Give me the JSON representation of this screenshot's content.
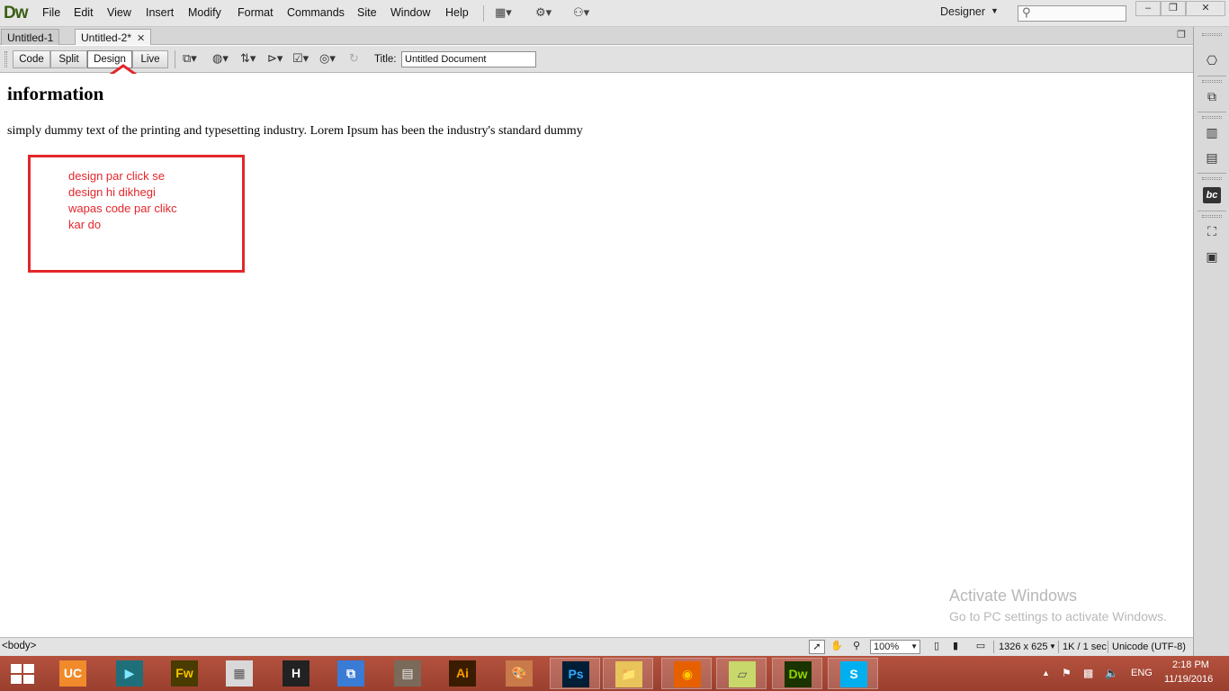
{
  "app": {
    "logo": "Dw",
    "menu": [
      "File",
      "Edit",
      "View",
      "Insert",
      "Modify",
      "Format",
      "Commands",
      "Site",
      "Window",
      "Help"
    ],
    "workspace": "Designer",
    "search_placeholder": "",
    "window_controls": [
      "–",
      "❐",
      "✕"
    ]
  },
  "tabs": [
    {
      "label": "Untitled-1",
      "active": false
    },
    {
      "label": "Untitled-2*",
      "active": true
    }
  ],
  "doc_toolbar": {
    "view_buttons": [
      "Code",
      "Split",
      "Design",
      "Live"
    ],
    "selected_view": "Design",
    "title_label": "Title:",
    "title_value": "Untitled Document"
  },
  "document": {
    "heading": "information",
    "paragraph": "simply dummy text of the printing and typesetting industry. Lorem Ipsum has been the industry's standard dummy"
  },
  "annotation": {
    "color": "#e3262b",
    "lines": [
      "design par click se",
      "design hi dikhegi",
      "wapas code par clikc",
      "kar do"
    ]
  },
  "watermark": {
    "title": "Activate Windows",
    "subtitle": "Go to PC settings to activate Windows."
  },
  "status_bar": {
    "tag_selector": "<body>",
    "zoom": "100%",
    "window_size": "1326 x 625",
    "download": "1K / 1 sec",
    "encoding": "Unicode (UTF-8)"
  },
  "taskbar": {
    "apps": [
      {
        "name": "uc-browser",
        "glyph": "UC",
        "bg": "#f08a2b",
        "fg": "#fff"
      },
      {
        "name": "media-player",
        "glyph": "▶",
        "bg": "#1f6f7a",
        "fg": "#7fe6ff"
      },
      {
        "name": "fireworks",
        "glyph": "Fw",
        "bg": "#4a3b00",
        "fg": "#f5c400"
      },
      {
        "name": "calculator",
        "glyph": "▦",
        "bg": "#d8d8d8",
        "fg": "#555"
      },
      {
        "name": "hyper-terminal",
        "glyph": "H",
        "bg": "#222",
        "fg": "#fff"
      },
      {
        "name": "network-tool",
        "glyph": "⧉",
        "bg": "#3a7bd5",
        "fg": "#fff"
      },
      {
        "name": "photos-app",
        "glyph": "▤",
        "bg": "#7a6a5a",
        "fg": "#eee"
      },
      {
        "name": "illustrator",
        "glyph": "Ai",
        "bg": "#3a1d00",
        "fg": "#ff9a00"
      },
      {
        "name": "paint",
        "glyph": "🎨",
        "bg": "#c87a4a",
        "fg": "#fff"
      },
      {
        "name": "photoshop",
        "glyph": "Ps",
        "bg": "#001e36",
        "fg": "#31a8ff"
      },
      {
        "name": "file-explorer",
        "glyph": "📁",
        "bg": "#e8c45a",
        "fg": "#7a5a00"
      },
      {
        "name": "firefox",
        "glyph": "◉",
        "bg": "#e66000",
        "fg": "#ffcb00"
      },
      {
        "name": "sticky-notes",
        "glyph": "▱",
        "bg": "#c9d86a",
        "fg": "#555"
      },
      {
        "name": "dreamweaver",
        "glyph": "Dw",
        "bg": "#1a3300",
        "fg": "#8fd400"
      },
      {
        "name": "skype",
        "glyph": "S",
        "bg": "#00aff0",
        "fg": "#fff"
      }
    ],
    "active_apps": [
      "photoshop",
      "file-explorer",
      "firefox",
      "sticky-notes",
      "dreamweaver",
      "skype"
    ],
    "language": "ENG",
    "time": "2:18 PM",
    "date": "11/19/2016"
  }
}
